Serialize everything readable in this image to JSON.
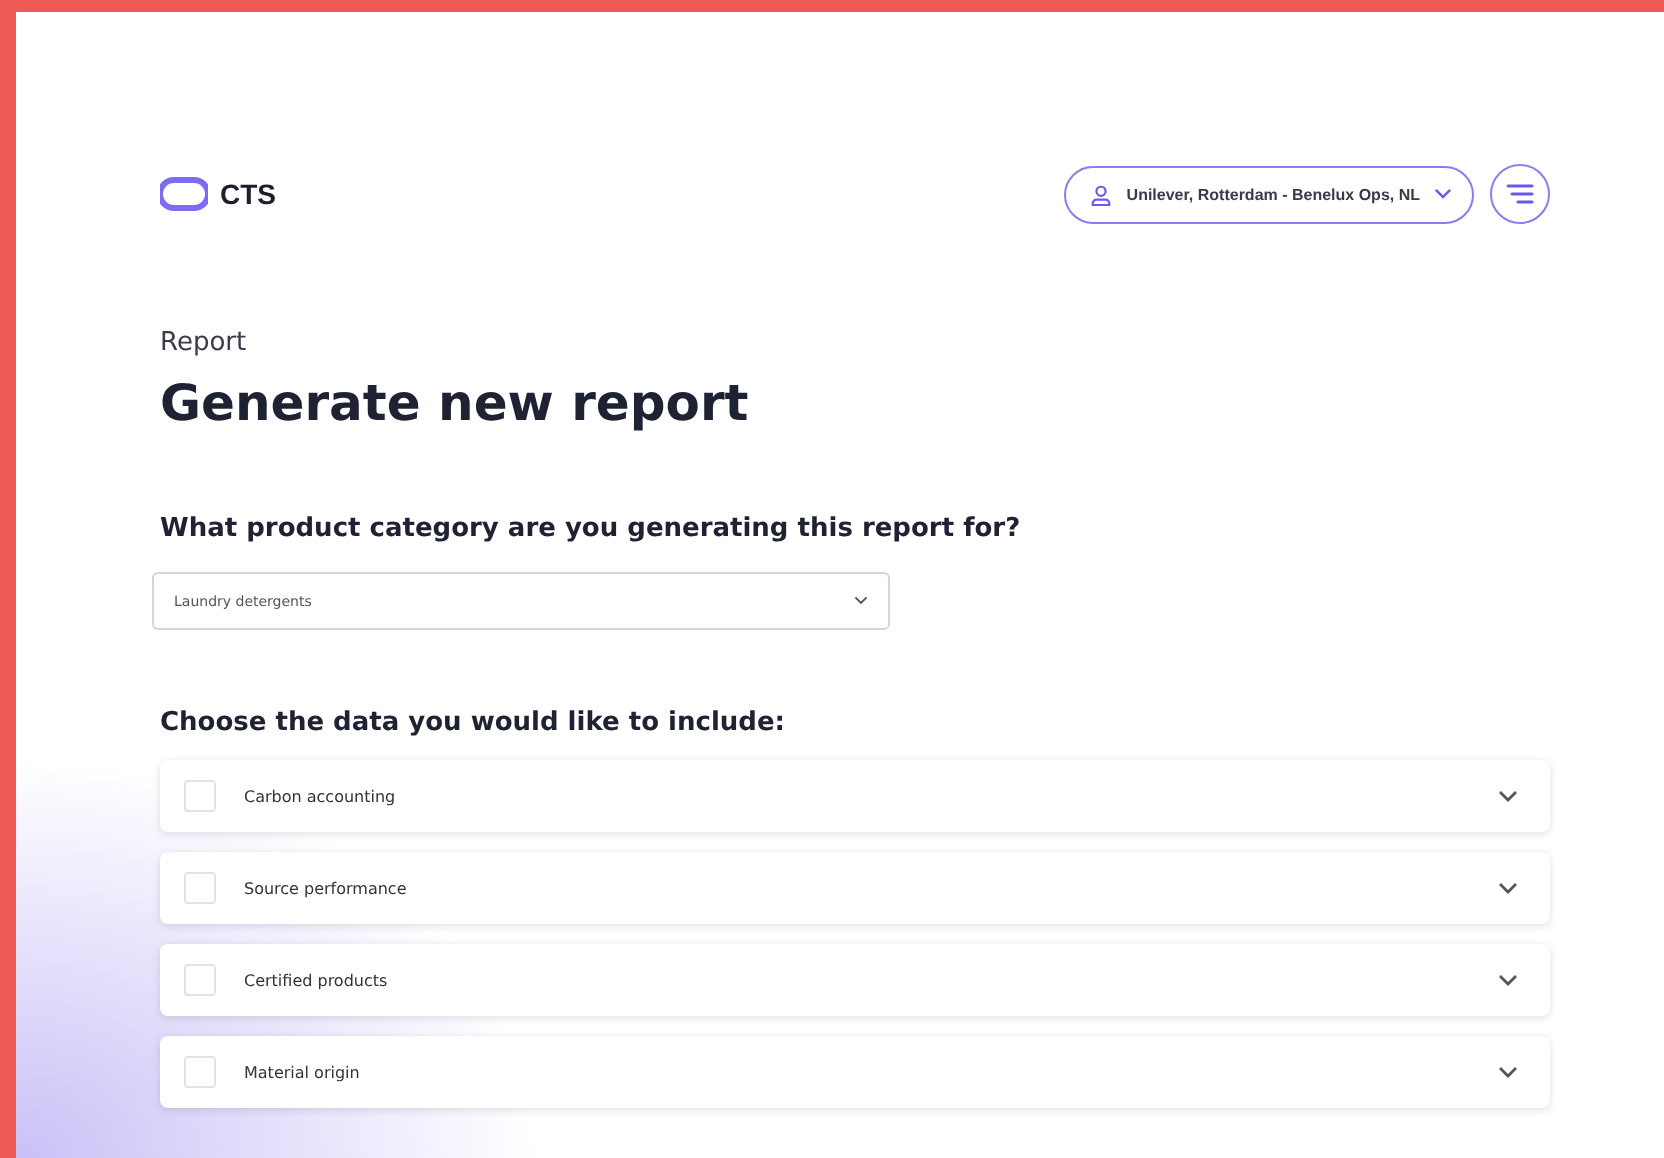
{
  "header": {
    "logo_text": "CTS",
    "account": "Unilever, Rotterdam - Benelux Ops, NL"
  },
  "page": {
    "eyebrow": "Report",
    "title": "Generate new report"
  },
  "category": {
    "question": "What product category are you generating this report for?",
    "value": "Laundry detergents"
  },
  "data_section": {
    "heading": "Choose the data you would like to include:",
    "items": [
      {
        "label": "Carbon accounting",
        "checked": false,
        "expanded": false
      },
      {
        "label": "Source performance",
        "checked": false,
        "expanded": false
      },
      {
        "label": "Certified products",
        "checked": false,
        "expanded": false
      },
      {
        "label": "Material origin",
        "checked": false,
        "expanded": false
      }
    ]
  }
}
